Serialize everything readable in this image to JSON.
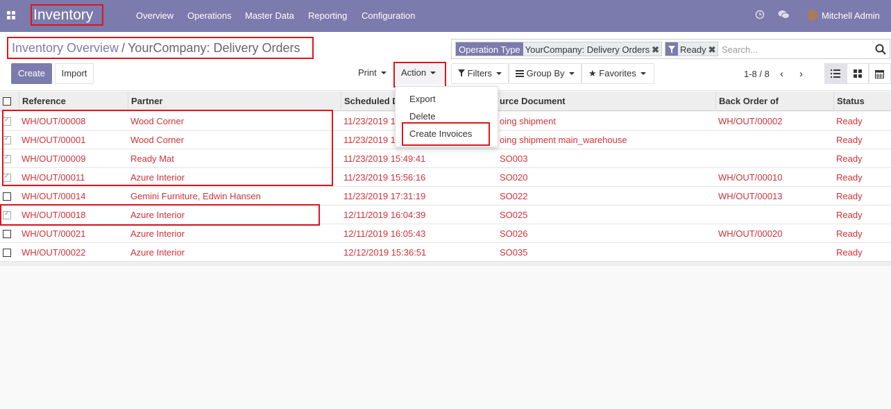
{
  "app": {
    "name": "Inventory"
  },
  "nav": [
    "Overview",
    "Operations",
    "Master Data",
    "Reporting",
    "Configuration"
  ],
  "user": {
    "name": "Mitchell Admin"
  },
  "breadcrumb": {
    "parent": "Inventory Overview",
    "separator": "/",
    "current": "YourCompany: Delivery Orders"
  },
  "search": {
    "facets": [
      {
        "title": "Operation Type",
        "value": "YourCompany: Delivery Orders"
      },
      {
        "title_icon": "filter-icon",
        "value": "Ready"
      }
    ],
    "placeholder": "Search..."
  },
  "buttons": {
    "create": "Create",
    "import": "Import",
    "print": "Print",
    "action": "Action",
    "filters": "Filters",
    "group_by": "Group By",
    "favorites": "Favorites"
  },
  "pager": {
    "text": "1-8 / 8"
  },
  "action_menu": {
    "items": [
      "Export",
      "Delete",
      "Create Invoices"
    ]
  },
  "table": {
    "columns": [
      "Reference",
      "Partner",
      "Scheduled D",
      "urce Document",
      "Back Order of",
      "Status"
    ],
    "rows": [
      {
        "checked": true,
        "reference": "WH/OUT/00008",
        "partner": "Wood Corner",
        "scheduled": "11/23/2019 1",
        "source": "oing shipment",
        "backorder": "WH/OUT/00002",
        "status": "Ready"
      },
      {
        "checked": true,
        "reference": "WH/OUT/00001",
        "partner": "Wood Corner",
        "scheduled": "11/23/2019 1",
        "source": "oing shipment main_warehouse",
        "backorder": "",
        "status": "Ready"
      },
      {
        "checked": true,
        "reference": "WH/OUT/00009",
        "partner": "Ready Mat",
        "scheduled": "11/23/2019 15:49:41",
        "source": "SO003",
        "backorder": "",
        "status": "Ready"
      },
      {
        "checked": true,
        "reference": "WH/OUT/00011",
        "partner": "Azure Interior",
        "scheduled": "11/23/2019 15:56:16",
        "source": "SO020",
        "backorder": "WH/OUT/00010",
        "status": "Ready"
      },
      {
        "checked": false,
        "reference": "WH/OUT/00014",
        "partner": "Gemini Furniture, Edwin Hansen",
        "scheduled": "11/23/2019 17:31:19",
        "source": "SO022",
        "backorder": "WH/OUT/00013",
        "status": "Ready"
      },
      {
        "checked": true,
        "reference": "WH/OUT/00018",
        "partner": "Azure Interior",
        "scheduled": "12/11/2019 16:04:39",
        "source": "SO025",
        "backorder": "",
        "status": "Ready"
      },
      {
        "checked": false,
        "reference": "WH/OUT/00021",
        "partner": "Azure Interior",
        "scheduled": "12/11/2019 16:05:43",
        "source": "SO026",
        "backorder": "WH/OUT/00020",
        "status": "Ready"
      },
      {
        "checked": false,
        "reference": "WH/OUT/00022",
        "partner": "Azure Interior",
        "scheduled": "12/12/2019 15:36:51",
        "source": "SO035",
        "backorder": "",
        "status": "Ready"
      }
    ]
  },
  "colors": {
    "brand": "#7c7bad",
    "link": "#d0323a",
    "highlight": "#e0141e"
  }
}
